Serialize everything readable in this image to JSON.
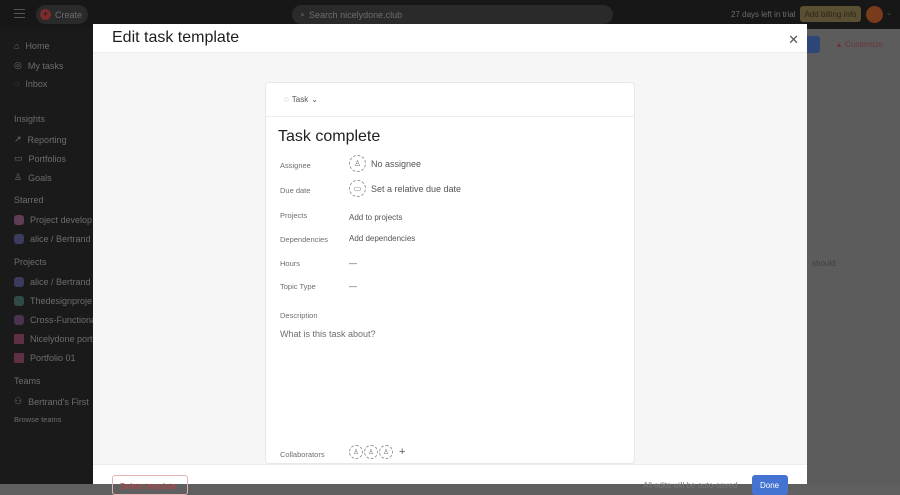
{
  "topbar": {
    "create_label": "Create",
    "search_placeholder": "Search nicelydone.club",
    "trial_text": "27 days left in trial",
    "billing_label": "Add billing info"
  },
  "sidebar": {
    "nav": [
      "Home",
      "My tasks",
      "Inbox"
    ],
    "insights_heading": "Insights",
    "insights": [
      "Reporting",
      "Portfolios",
      "Goals"
    ],
    "starred_heading": "Starred",
    "starred": [
      {
        "label": "Project develop",
        "color": "#5e3d55"
      },
      {
        "label": "alice / Bertrand",
        "color": "#3b3b5e"
      }
    ],
    "projects_heading": "Projects",
    "projects": [
      {
        "label": "alice / Bertrand",
        "color": "#3b3b5e"
      },
      {
        "label": "Thedesignproje",
        "color": "#2f4a47"
      },
      {
        "label": "Cross-Functiona",
        "color": "#4a3250"
      },
      {
        "label": "Nicelydone port",
        "color": "#5e2f45"
      },
      {
        "label": "Portfolio 01",
        "color": "#5e2f45"
      }
    ],
    "teams_heading": "Teams",
    "teams": [
      "Bertrand's First"
    ],
    "browse_teams": "Browse teams"
  },
  "background": {
    "customize_label": "Customize",
    "hint_text": "should"
  },
  "modal": {
    "title": "Edit task template",
    "type_label": "Task",
    "task_title": "Task complete",
    "fields": {
      "assignee_label": "Assignee",
      "assignee_value": "No assignee",
      "due_label": "Due date",
      "due_value": "Set a relative due date",
      "projects_label": "Projects",
      "projects_value": "Add to projects",
      "deps_label": "Dependencies",
      "deps_value": "Add dependencies",
      "hours_label": "Hours",
      "hours_value": "—",
      "topic_label": "Topic Type",
      "topic_value": "—",
      "desc_label": "Description",
      "desc_placeholder": "What is this task about?",
      "collab_label": "Collaborators"
    },
    "footer": {
      "delete_label": "Delete template",
      "autosave_text": "All edits will be auto-saved",
      "done_label": "Done"
    }
  }
}
